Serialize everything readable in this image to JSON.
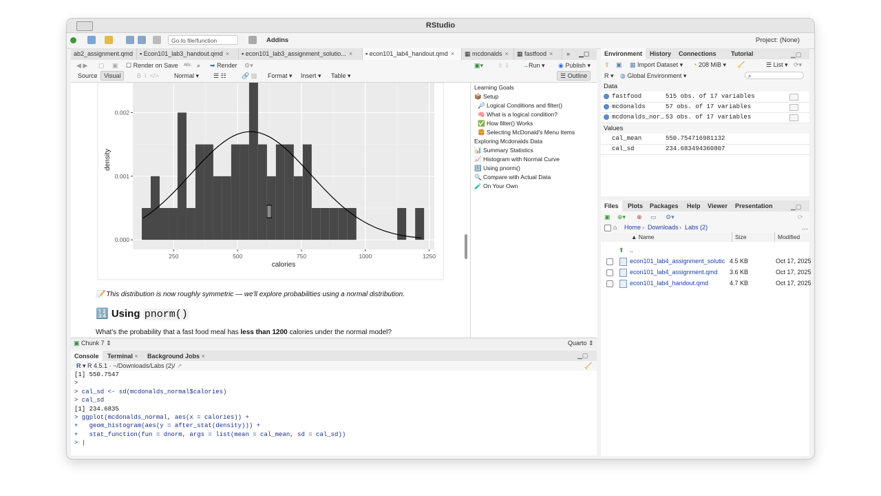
{
  "window": {
    "title": "RStudio"
  },
  "toolbar": {
    "goto_placeholder": "Go to file/function",
    "addins": "Addins",
    "project": "Project: (None)"
  },
  "editor": {
    "tabs": [
      {
        "label": "ab2_assignment.qmd"
      },
      {
        "label": "Econ101_lab3_handout.qmd"
      },
      {
        "label": "econ101_lab3_assignment_solutio..."
      },
      {
        "label": "econ101_lab4_handout.qmd"
      },
      {
        "label": "mcdonalds"
      },
      {
        "label": "fastfood"
      }
    ],
    "render_on_save": "Render on Save",
    "render": "Render",
    "run": "Run",
    "publish": "Publish",
    "source": "Source",
    "visual": "Visual",
    "normal": "Normal",
    "format": "Format",
    "insert": "Insert",
    "table": "Table",
    "outline_btn": "Outline",
    "status_chunk": "Chunk 7",
    "status_mode": "Quarto"
  },
  "doc": {
    "note": "This distribution is now roughly symmetric — we'll explore probabilities using a normal distribution.",
    "heading_prefix": "🔢 Using ",
    "heading_code": "pnorm()",
    "question_pre": "What's the probability that a fast food meal has ",
    "question_bold": "less than 1200",
    "question_post": " calories under the normal model?"
  },
  "chart_data": {
    "type": "histogram",
    "xlabel": "calories",
    "ylabel": "density",
    "xlim": [
      90,
      1270
    ],
    "ylim": [
      -0.00015,
      0.00247
    ],
    "xticks": [
      250,
      500,
      750,
      1000,
      1250
    ],
    "yticks": [
      0.0,
      0.001,
      0.002
    ],
    "ytick_labels": [
      "0.000",
      "0.001",
      "0.002"
    ],
    "binwidth": 35,
    "bins": [
      {
        "x0": 125,
        "y": 0.0005
      },
      {
        "x0": 160,
        "y": 0.001
      },
      {
        "x0": 195,
        "y": 0.0005
      },
      {
        "x0": 230,
        "y": 0.0005
      },
      {
        "x0": 265,
        "y": 0.002
      },
      {
        "x0": 300,
        "y": 0.0005
      },
      {
        "x0": 335,
        "y": 0.0015
      },
      {
        "x0": 370,
        "y": 0.0015
      },
      {
        "x0": 405,
        "y": 0.001
      },
      {
        "x0": 440,
        "y": 0.001
      },
      {
        "x0": 475,
        "y": 0.0015
      },
      {
        "x0": 510,
        "y": 0.0015
      },
      {
        "x0": 545,
        "y": 0.0025
      },
      {
        "x0": 580,
        "y": 0.0015
      },
      {
        "x0": 615,
        "y": 0.001
      },
      {
        "x0": 650,
        "y": 0.0015
      },
      {
        "x0": 685,
        "y": 0.0015
      },
      {
        "x0": 720,
        "y": 0.001
      },
      {
        "x0": 755,
        "y": 0.0015
      },
      {
        "x0": 790,
        "y": 0.0005
      },
      {
        "x0": 825,
        "y": 0.0005
      },
      {
        "x0": 860,
        "y": 0.0005
      },
      {
        "x0": 895,
        "y": 0.0005
      },
      {
        "x0": 930,
        "y": 0.0005
      },
      {
        "x0": 1125,
        "y": 0.0005
      },
      {
        "x0": 1195,
        "y": 0.0005
      }
    ],
    "normal_curve": {
      "mean": 550.7547,
      "sd": 234.6835,
      "from": 130,
      "to": 1220
    }
  },
  "outline": {
    "items": [
      {
        "label": "Learning Goals",
        "icon": ""
      },
      {
        "label": "Setup",
        "icon": "📦"
      },
      {
        "label": "Logical Conditions and filter()",
        "icon": "🔎"
      },
      {
        "label": "What is a logical condition?",
        "icon": "🧠"
      },
      {
        "label": "How filter() Works",
        "icon": "✅"
      },
      {
        "label": "Selecting McDonald's Menu Items",
        "icon": "🍔"
      },
      {
        "label": "Exploring Mcdonalds Data",
        "icon": ""
      },
      {
        "label": "Summary Statistics",
        "icon": "📊"
      },
      {
        "label": "Histogram with Normal Curve",
        "icon": "📈"
      },
      {
        "label": "Using pnorm()",
        "icon": "🔢"
      },
      {
        "label": "Compare with Actual Data",
        "icon": "🔍"
      },
      {
        "label": "On Your Own",
        "icon": "🧪"
      }
    ]
  },
  "console": {
    "tabs": [
      "Console",
      "Terminal",
      "Background Jobs"
    ],
    "version": "R 4.5.1",
    "path": "~/Downloads/Labs (2)/",
    "lines": [
      {
        "text": "[1] 550.7547",
        "kind": "out"
      },
      {
        "text": ">",
        "kind": "in"
      },
      {
        "text": "> cal_sd <- sd(mcdonalds_normal$calories)",
        "kind": "in"
      },
      {
        "text": "> cal_sd",
        "kind": "in"
      },
      {
        "text": "[1] 234.6835",
        "kind": "out"
      },
      {
        "text": "> ggplot(mcdonalds_normal, aes(x = calories)) +",
        "kind": "in"
      },
      {
        "text": "+   geom_histogram(aes(y = after_stat(density))) +",
        "kind": "in"
      },
      {
        "text": "+   stat_function(fun = dnorm, args = list(mean = cal_mean, sd = cal_sd))",
        "kind": "in"
      },
      {
        "text": "> |",
        "kind": "in"
      }
    ]
  },
  "environment": {
    "tabs": [
      "Environment",
      "History",
      "Connections",
      "Tutorial"
    ],
    "import": "Import Dataset",
    "memory": "208 MiB",
    "list": "List",
    "lang": "R",
    "scope": "Global Environment",
    "data_header": "Data",
    "values_header": "Values",
    "data": [
      {
        "name": "fastfood",
        "value": "515 obs. of 17 variables"
      },
      {
        "name": "mcdonalds",
        "value": "57 obs. of 17 variables"
      },
      {
        "name": "mcdonalds_nor…",
        "value": "53 obs. of 17 variables"
      }
    ],
    "values": [
      {
        "name": "cal_mean",
        "value": "550.754716981132"
      },
      {
        "name": "cal_sd",
        "value": "234.683494360807"
      }
    ]
  },
  "files": {
    "tabs": [
      "Files",
      "Plots",
      "Packages",
      "Help",
      "Viewer",
      "Presentation"
    ],
    "breadcrumb": [
      "Home",
      "Downloads",
      "Labs (2)"
    ],
    "columns": {
      "name": "Name",
      "size": "Size",
      "modified": "Modified"
    },
    "up": "..",
    "rows": [
      {
        "name": "econ101_lab4_assignment_solutic",
        "size": "4.5 KB",
        "modified": "Oct 17, 2025"
      },
      {
        "name": "econ101_lab4_assignment.qmd",
        "size": "3.6 KB",
        "modified": "Oct 17, 2025"
      },
      {
        "name": "econ101_lab4_handout.qmd",
        "size": "4.7 KB",
        "modified": "Oct 17, 2025"
      }
    ]
  }
}
